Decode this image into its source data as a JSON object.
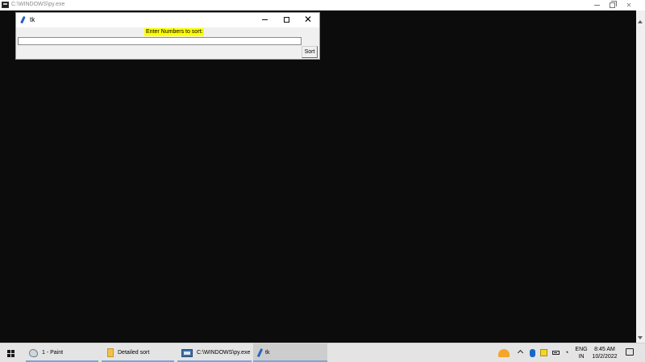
{
  "console": {
    "title": "C:\\WINDOWS\\py.exe"
  },
  "tk_window": {
    "title": "tk",
    "label": "Enter Numbers to sort:",
    "entry_value": "",
    "button_label": "Sort"
  },
  "taskbar": {
    "items": [
      {
        "label": "1 - Paint",
        "icon": "paint-icon"
      },
      {
        "label": "Detailed sort",
        "icon": "folder-icon"
      },
      {
        "label": "C:\\WINDOWS\\py.exe",
        "icon": "python-console-icon"
      },
      {
        "label": "tk",
        "icon": "tk-feather-icon"
      }
    ],
    "lang_top": "ENG",
    "lang_bottom": "IN",
    "time": "8:45 AM",
    "date": "10/2/2022"
  },
  "colors": {
    "console_bg": "#0c0c0c",
    "label_highlight": "#ffff00",
    "taskbar_bg": "#e4e4e4"
  }
}
